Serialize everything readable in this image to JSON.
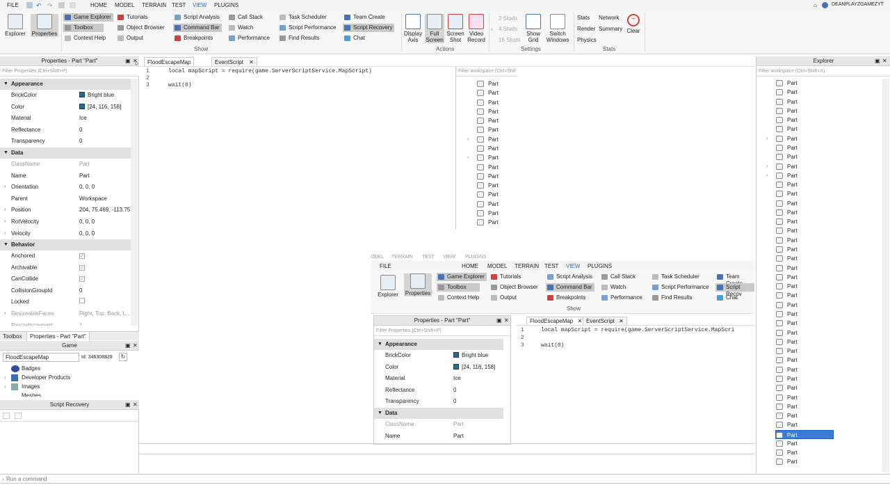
{
  "menubar": {
    "items": [
      "FILE",
      "HOME",
      "MODEL",
      "TERRAIN",
      "TEST",
      "VIEW",
      "PLUGINS"
    ],
    "user": "DEANPLAYZGAMEZYT"
  },
  "ribbon": {
    "explorer": "Explorer",
    "properties": "Properties",
    "show_items": [
      "Game Explorer",
      "Toolbox",
      "Context Help",
      "Tutorials",
      "Object Browser",
      "Output",
      "Script Analysis",
      "Command Bar",
      "Breakpoints",
      "Call Stack",
      "Watch",
      "Performance",
      "Task Scheduler",
      "Script Performance",
      "Find Results",
      "Team Create",
      "Script Recovery",
      "Chat"
    ],
    "show_label": "Show",
    "actions": [
      "Display Axis",
      "Full Screen",
      "Screen Shot",
      "Video Record"
    ],
    "actions_label": "Actions",
    "studs": [
      "2 Studs",
      "4 Studs",
      "16 Studs"
    ],
    "settings_btns": [
      "Show Grid",
      "Switch Windows"
    ],
    "settings_label": "Settings",
    "stats": [
      "Stats",
      "Render",
      "Physics",
      "Network",
      "Summary"
    ],
    "clear": "Clear",
    "stats_label": "Stats"
  },
  "properties_panel": {
    "title": "Properties - Part \"Part\"",
    "filter": "Filter Properties (Ctrl+Shift+P)",
    "categories": {
      "appearance": "Appearance",
      "data": "Data",
      "behavior": "Behavior"
    },
    "appearance": [
      {
        "name": "BrickColor",
        "value": "Bright blue"
      },
      {
        "name": "Color",
        "value": "[24, 116, 158]"
      },
      {
        "name": "Material",
        "value": "Ice"
      },
      {
        "name": "Reflectance",
        "value": "0"
      },
      {
        "name": "Transparency",
        "value": "0"
      }
    ],
    "data": [
      {
        "name": "ClassName",
        "value": "Part"
      },
      {
        "name": "Name",
        "value": "Part"
      },
      {
        "name": "Orientation",
        "value": "0, 0, 0"
      },
      {
        "name": "Parent",
        "value": "Workspace"
      },
      {
        "name": "Position",
        "value": "204, 75.469, -113.75"
      },
      {
        "name": "RotVelocity",
        "value": "0, 0, 0"
      },
      {
        "name": "Velocity",
        "value": "0, 0, 0"
      }
    ],
    "behavior": [
      {
        "name": "Anchored",
        "value": "✓"
      },
      {
        "name": "Archivable",
        "value": "✓"
      },
      {
        "name": "CanCollide",
        "value": "✓"
      },
      {
        "name": "CollisionGroupId",
        "value": "0"
      },
      {
        "name": "Locked",
        "value": ""
      },
      {
        "name": "ResizeableFaces",
        "value": "Right, Top, Back, L..."
      },
      {
        "name": "ResizeIncrement",
        "value": "1"
      }
    ],
    "bottom_tabs": [
      "Toolbox",
      "Properties - Part \"Part\""
    ]
  },
  "game_panel": {
    "title": "Game",
    "place": "FloodEscapeMap",
    "id": "Id: 346308828",
    "items": [
      "Badges",
      "Developer Products",
      "Images",
      "Meshes"
    ]
  },
  "script_recovery": {
    "title": "Script Recovery"
  },
  "editor": {
    "tabs": [
      "FloodEscapeMap",
      "EventScript"
    ],
    "line_numbers": [
      "1",
      "2",
      "3"
    ],
    "lines": [
      "local mapScript = require(game.ServerScriptService.MapScript)",
      "",
      "wait(0)"
    ],
    "filter": "Filter workspace (Ctrl+Shif"
  },
  "mini_list": {
    "items": [
      "Part",
      "Part",
      "Part",
      "Part",
      "Part",
      "Part",
      "Part",
      "Part",
      "Part",
      "Part",
      "Part",
      "Part",
      "Part",
      "Part",
      "Part",
      "Part"
    ]
  },
  "explorer": {
    "title": "Explorer",
    "filter": "Filter workspace (Ctrl+Shift+X)",
    "items": [
      "Part",
      "Part",
      "Part",
      "Part",
      "Part",
      "Part",
      "Part",
      "Part",
      "Part",
      "Part",
      "Part",
      "Part",
      "Part",
      "Part",
      "Part",
      "Part",
      "Part",
      "Part",
      "Part",
      "Part",
      "Part",
      "Part",
      "Part",
      "Part",
      "Part",
      "Part",
      "Part",
      "Part",
      "Part",
      "Part",
      "Part",
      "Part",
      "Part",
      "Part",
      "Part",
      "Part",
      "Part",
      "Part",
      "Part",
      "Part",
      "Part",
      "Part"
    ],
    "selected_index": 38
  },
  "nested": {
    "menu": [
      "FILE",
      "HOME",
      "MODEL",
      "TERRAIN",
      "TEST",
      "VIEW",
      "PLUGINS"
    ],
    "ghost_menu": [
      "ODEL",
      "TERRAIN",
      "TEST",
      "VIEW",
      "PLUGINS"
    ],
    "show_items": [
      "Game Explorer",
      "Toolbox",
      "Context Help",
      "Tutorials",
      "Object Browser",
      "Output",
      "Script Analysis",
      "Command Bar",
      "Breakpoints",
      "Call Stack",
      "Watch",
      "Performance",
      "Task Scheduler",
      "Script Performance",
      "Find Results",
      "Team Create",
      "Script Recov",
      "Chat"
    ],
    "show_label": "Show",
    "props_title": "Properties - Part \"Part\"",
    "filter": "Filter Properties (Ctrl+Shift+P)",
    "rows": [
      {
        "name": "BrickColor",
        "value": "Bright blue"
      },
      {
        "name": "Color",
        "value": "[24, 116, 158]"
      },
      {
        "name": "Material",
        "value": "Ice"
      },
      {
        "name": "Reflectance",
        "value": "0"
      },
      {
        "name": "Transparency",
        "value": "0"
      }
    ],
    "data_rows": [
      {
        "name": "ClassName",
        "value": "Part"
      },
      {
        "name": "Name",
        "value": "Part"
      }
    ],
    "tabs": [
      "FloodEscapeMap",
      "EventScript"
    ],
    "code": [
      "local mapScript = require(game.ServerScriptService.MapScri",
      "",
      "wait(0)"
    ]
  },
  "command_bar": {
    "placeholder": "Run a command"
  }
}
